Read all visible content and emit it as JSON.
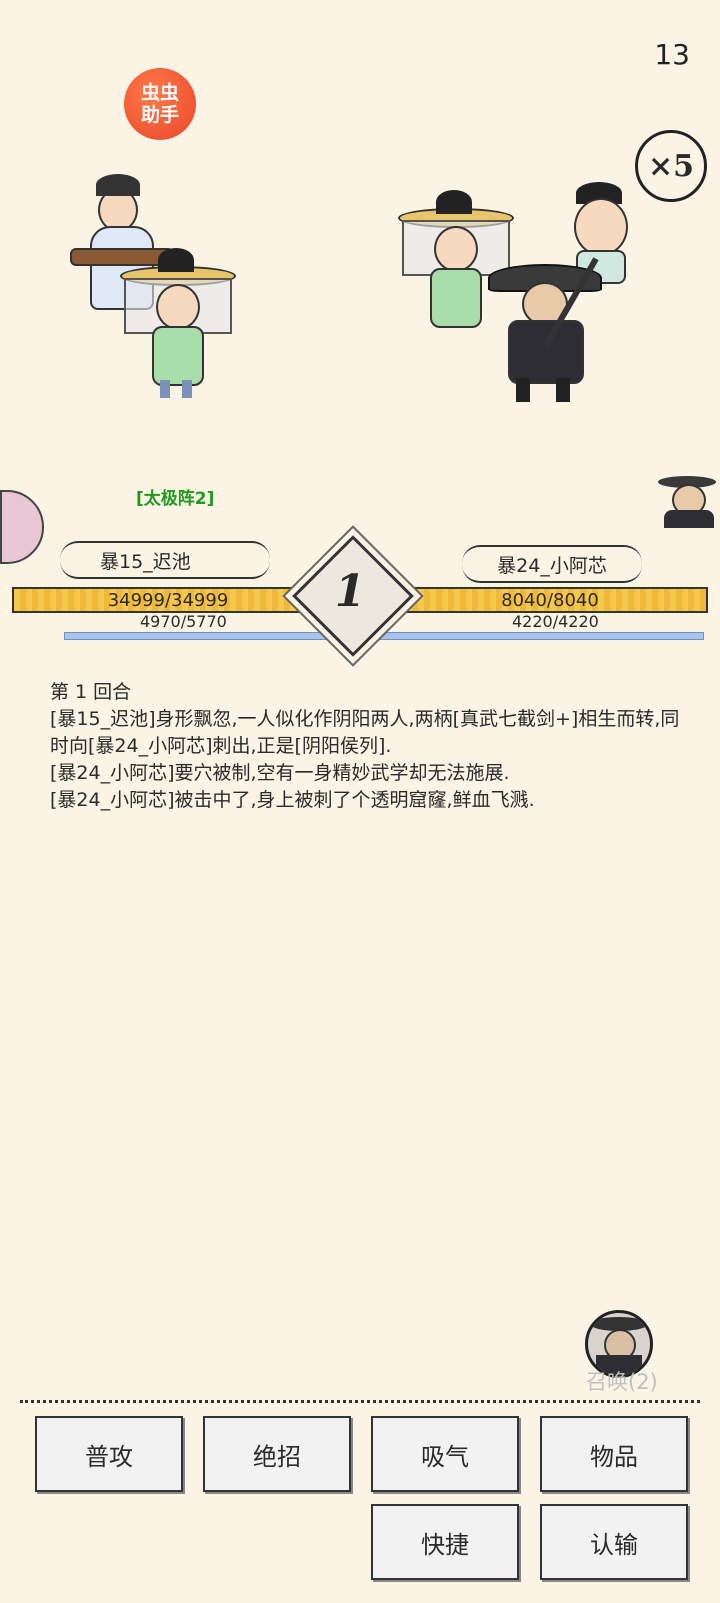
{
  "status": {
    "timer": "13"
  },
  "overlay": {
    "helper_badge": "虫虫\n助手",
    "speed": "×5"
  },
  "battle": {
    "formation": "[太极阵2]",
    "round": "1",
    "left": {
      "name": "暴15_迟池",
      "hp_text": "34999/34999",
      "mp_text": "4970/5770",
      "mp_fraction": 0.86
    },
    "right": {
      "name": "暴24_小阿芯",
      "hp_text": "8040/8040",
      "mp_text": "4220/4220",
      "mp_fraction": 1.0
    }
  },
  "log": {
    "round_title": "第 1 回合",
    "lines": [
      "[暴15_迟池]身形飘忽,一人似化作阴阳两人,两柄[真武七截剑+]相生而转,同时向[暴24_小阿芯]刺出,正是[阴阳侯列].",
      "[暴24_小阿芯]要穴被制,空有一身精妙武学却无法施展.",
      "[暴24_小阿芯]被击中了,身上被刺了个透明窟窿,鲜血飞溅."
    ]
  },
  "summon": {
    "label": "召唤(2)"
  },
  "actions": {
    "attack": "普攻",
    "ultimate": "绝招",
    "breathe": "吸气",
    "items": "物品",
    "quick": "快捷",
    "surrender": "认输"
  },
  "icons": {
    "helper": "helper-app-icon",
    "speed": "speed-multiplier-icon",
    "summon": "summon-avatar-icon"
  }
}
